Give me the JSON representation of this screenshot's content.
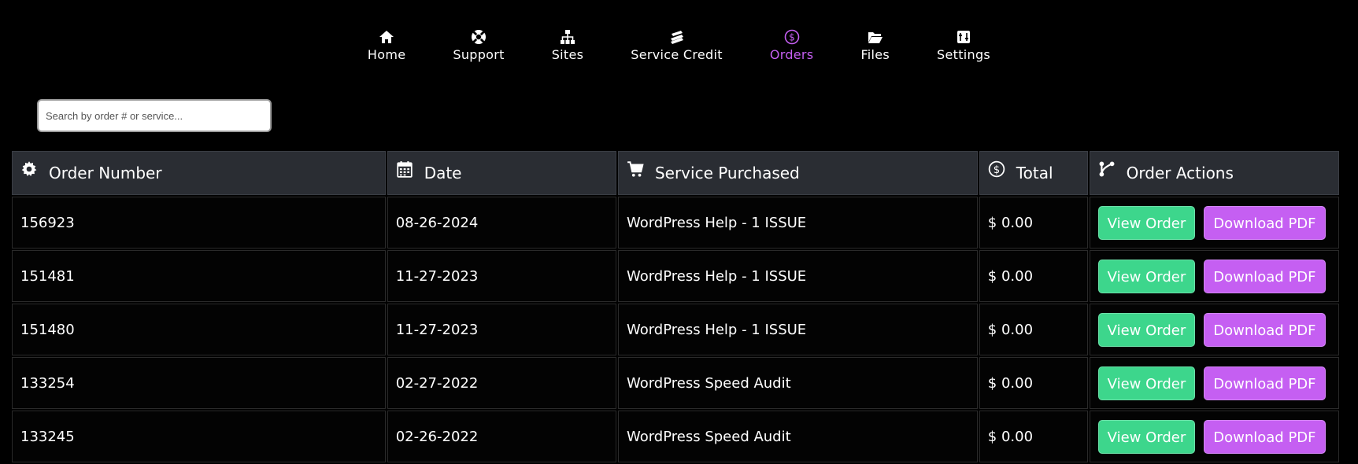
{
  "nav": {
    "items": [
      {
        "label": "Home",
        "icon": "home-icon"
      },
      {
        "label": "Support",
        "icon": "lifebuoy-icon"
      },
      {
        "label": "Sites",
        "icon": "sitemap-icon"
      },
      {
        "label": "Service Credit",
        "icon": "money-stack-icon"
      },
      {
        "label": "Orders",
        "icon": "dollar-circle-icon",
        "active": true
      },
      {
        "label": "Files",
        "icon": "folder-open-icon"
      },
      {
        "label": "Settings",
        "icon": "sliders-icon"
      }
    ],
    "active_color": "#c55ff2"
  },
  "search": {
    "placeholder": "Search by order # or service...",
    "value": ""
  },
  "table": {
    "headers": {
      "order_number": "Order Number",
      "date": "Date",
      "service": "Service Purchased",
      "total": "Total",
      "actions": "Order Actions"
    },
    "header_icons": {
      "order_number": "gear-icon",
      "date": "calendar-icon",
      "service": "cart-icon",
      "total": "dollar-circle-icon",
      "actions": "branch-icon"
    },
    "rows": [
      {
        "order_number": "156923",
        "date": "08-26-2024",
        "service": "WordPress Help - 1 ISSUE",
        "total": "$ 0.00"
      },
      {
        "order_number": "151481",
        "date": "11-27-2023",
        "service": "WordPress Help - 1 ISSUE",
        "total": "$ 0.00"
      },
      {
        "order_number": "151480",
        "date": "11-27-2023",
        "service": "WordPress Help - 1 ISSUE",
        "total": "$ 0.00"
      },
      {
        "order_number": "133254",
        "date": "02-27-2022",
        "service": "WordPress Speed Audit",
        "total": "$ 0.00"
      },
      {
        "order_number": "133245",
        "date": "02-26-2022",
        "service": "WordPress Speed Audit",
        "total": "$ 0.00"
      }
    ],
    "view_label": "View Order",
    "pdf_label": "Download PDF"
  },
  "colors": {
    "background": "#000000",
    "header_bg": "#2a2d33",
    "view_button": "#3dd68c",
    "pdf_button": "#c55ff2"
  }
}
